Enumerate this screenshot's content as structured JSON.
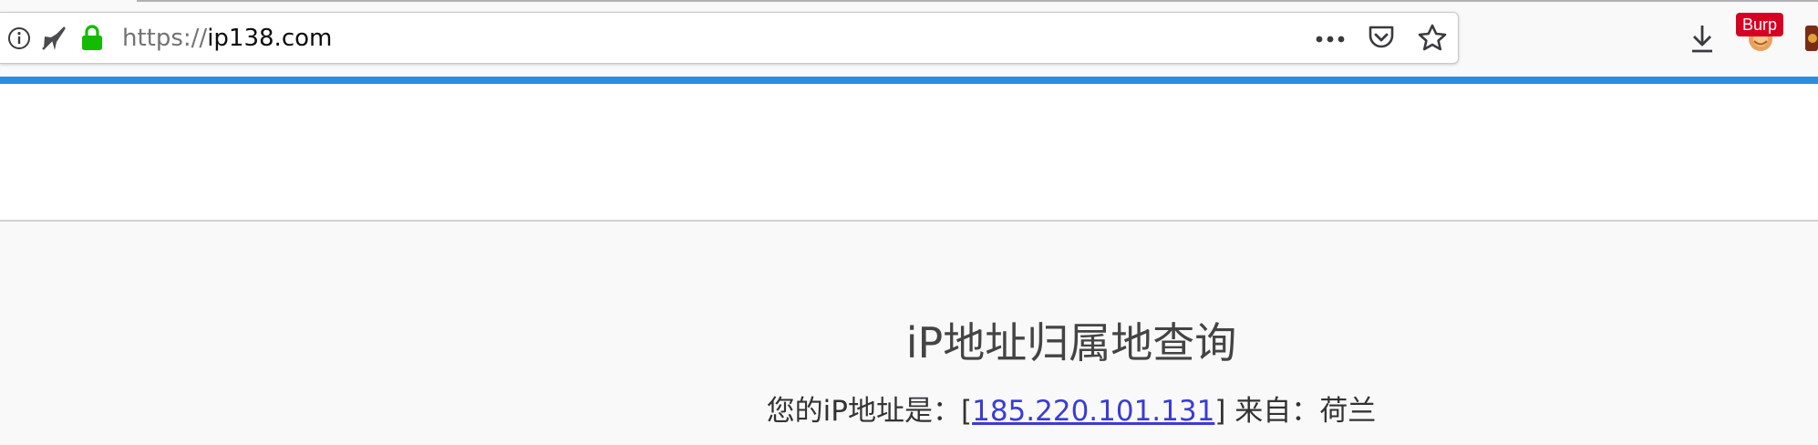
{
  "browser": {
    "url_scheme": "https://",
    "url_host": "ip138.com",
    "extension_badge": "Burp",
    "icons": {
      "site_info": "info-circle-icon",
      "tracking": "tracking-protection-icon",
      "secure": "green-padlock-icon",
      "page_actions": "more-horizontal-icon",
      "pocket": "pocket-icon",
      "bookmark": "star-icon",
      "downloads": "download-arrow-icon",
      "extension": "burp-extension-icon",
      "extension_edge": "extension-icon"
    },
    "colors": {
      "secure": "#12bc00",
      "progress": "#2b8de0",
      "badge": "#d70022"
    }
  },
  "page": {
    "title": "iP地址归属地查询",
    "ip_prefix": "您的iP地址是：[",
    "ip_address": "185.220.101.131",
    "ip_suffix": "] 来自：荷兰",
    "link_color": "#3b3bd6"
  }
}
